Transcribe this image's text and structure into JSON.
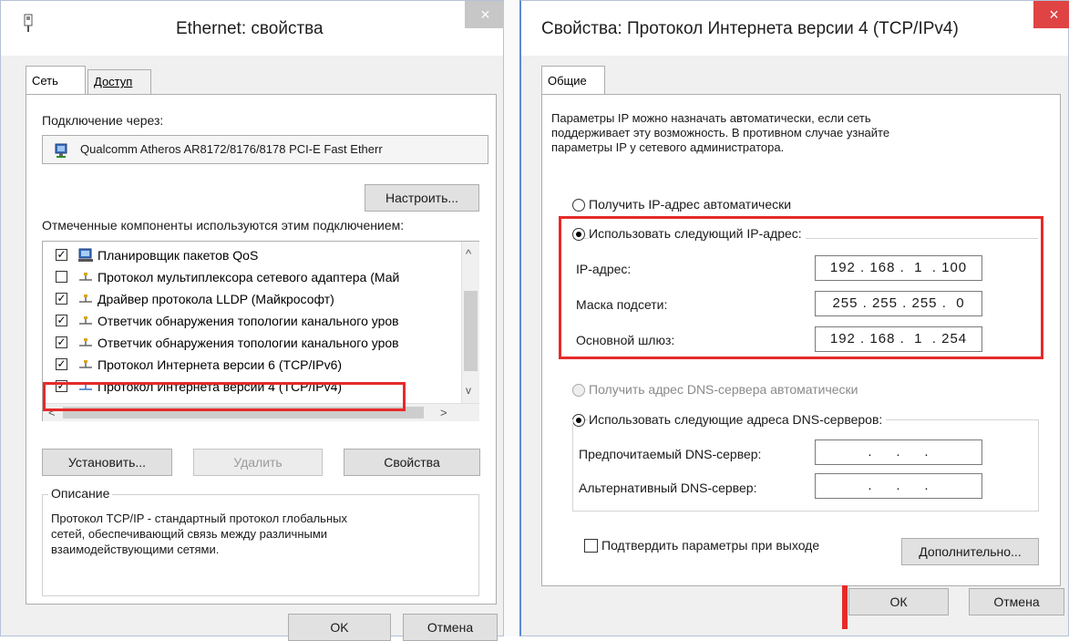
{
  "left_dialog": {
    "title": "Ethernet: свойства",
    "close_symbol": "×",
    "tabs": [
      {
        "label": "Сеть"
      },
      {
        "label": "Доступ"
      }
    ],
    "connect_via_label": "Подключение через:",
    "adapter_name": "Qualcomm Atheros AR8172/8176/8178 PCI-E Fast Etherr",
    "configure_button": "Настроить...",
    "components_label": "Отмеченные компоненты используются этим подключением:",
    "components": [
      {
        "label": "Планировщик пакетов QoS",
        "checked": true
      },
      {
        "label": "Протокол мультиплексора сетевого адаптера (Май",
        "checked": false
      },
      {
        "label": "Драйвер протокола LLDP (Майкрософт)",
        "checked": true
      },
      {
        "label": "Ответчик обнаружения топологии канального уров",
        "checked": true
      },
      {
        "label": "Ответчик обнаружения топологии канального уров",
        "checked": true
      },
      {
        "label": "Протокол Интернета версии 6 (TCP/IPv6)",
        "checked": true
      },
      {
        "label": "Протокол Интернета версии 4 (TCP/IPv4)",
        "checked": true
      }
    ],
    "check_mark": "✓",
    "scroll_up": "^",
    "scroll_down": "v",
    "scroll_left": "<",
    "scroll_right": ">",
    "install_button": "Установить...",
    "remove_button": "Удалить",
    "properties_button": "Свойства",
    "description_group_label": "Описание",
    "description_text": [
      "Протокол TCP/IP - стандартный протокол глобальных",
      "сетей, обеспечивающий связь между различными",
      "взаимодействующими сетями."
    ],
    "ok_button": "OK",
    "cancel_button": "Отмена"
  },
  "right_dialog": {
    "title": "Свойства: Протокол Интернета версии 4 (TCP/IPv4)",
    "close_symbol": "×",
    "tabs": [
      {
        "label": "Общие"
      }
    ],
    "intro_text": [
      "Параметры IP можно назначать автоматически, если сеть",
      "поддерживает эту возможность. В противном случае узнайте",
      "параметры IP у сетевого администратора."
    ],
    "radio_auto_ip": "Получить IP-адрес автоматически",
    "radio_manual_ip": "Использовать следующий IP-адрес:",
    "ip_label": "IP-адрес:",
    "ip_value": "192 . 168 .  1  . 100",
    "mask_label": "Маска подсети:",
    "mask_value": "255 . 255 . 255 .  0",
    "gateway_label": "Основной шлюз:",
    "gateway_value": "192 . 168 .  1  . 254",
    "radio_auto_dns": "Получить адрес DNS-сервера автоматически",
    "radio_manual_dns": "Использовать следующие адреса DNS-серверов:",
    "preferred_dns_label": "Предпочитаемый DNS-сервер:",
    "preferred_dns_value": " .     .     . ",
    "alternate_dns_label": "Альтернативный DNS-сервер:",
    "alternate_dns_value": " .     .     . ",
    "validate_label": "Подтвердить параметры при выходе",
    "advanced_button": "Дополнительно...",
    "ok_button": "ОК",
    "cancel_button": "Отмена"
  },
  "colors": {
    "highlight_red": "#e62a2a",
    "close_button_red": "#e04343",
    "close_button_inactive": "#c7c7c7"
  }
}
